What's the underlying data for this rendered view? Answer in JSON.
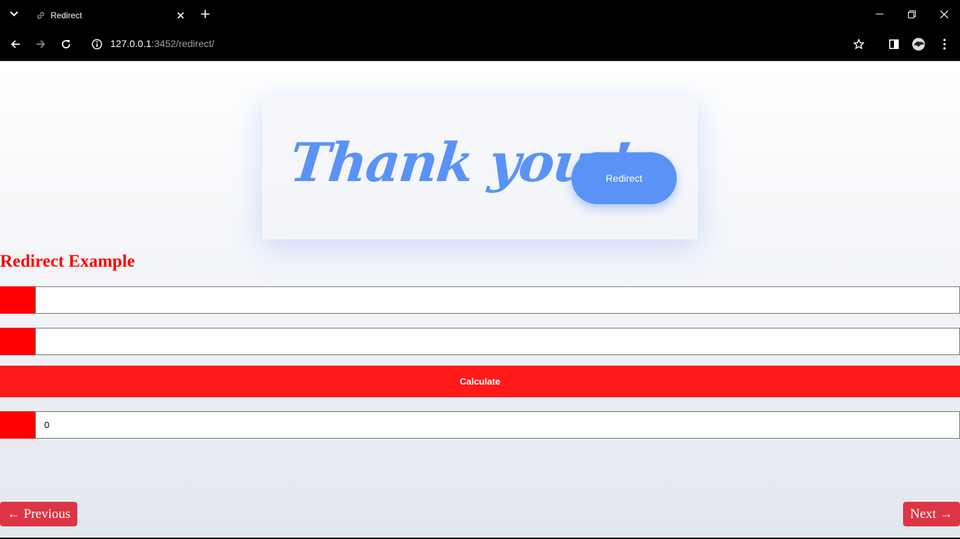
{
  "browser": {
    "tab_title": "Redirect",
    "url_host": "127.0.0.1",
    "url_path": ":3452/redirect/",
    "icons": {
      "tab_menu": "chevron-down-icon",
      "favicon": "link-icon",
      "close": "close-icon",
      "new_tab": "plus-icon",
      "back": "arrow-left-icon",
      "forward": "arrow-right-icon",
      "reload": "reload-icon",
      "site_info": "info-icon",
      "bookmark": "star-icon",
      "side_panel": "side-panel-icon",
      "profile": "profile-avatar-icon",
      "menu": "kebab-menu-icon"
    }
  },
  "card": {
    "thanks_text": "Thank you !",
    "redirect_label": "Redirect"
  },
  "form": {
    "heading": "Redirect Example",
    "input1_value": "",
    "input2_value": "",
    "calculate_label": "Calculate",
    "result_value": "0"
  },
  "pager": {
    "previous_label": "← Previous",
    "next_label": "Next →"
  },
  "colors": {
    "accent_blue": "#5a93f5",
    "red": "#ff0000",
    "calculate_red": "#ff1a1a",
    "pager_red": "#dc3545"
  }
}
